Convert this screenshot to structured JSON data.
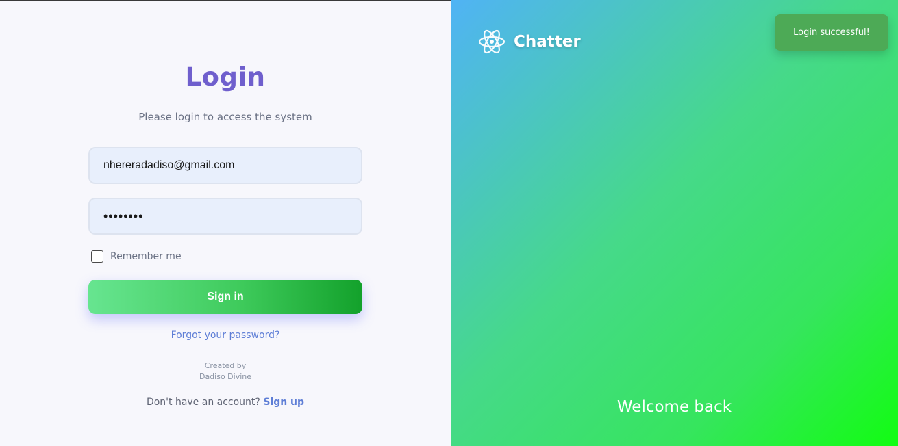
{
  "login": {
    "title": "Login",
    "subtitle": "Please login to access the system",
    "email_value": "nhereradadiso@gmail.com",
    "password_value": "••••••••",
    "remember_label": "Remember me",
    "signin_label": "Sign in",
    "forgot_label": "Forgot your password?",
    "credit_line1": "Created by",
    "credit_line2": "Dadiso Divine",
    "signup_prompt": "Don't have an account?",
    "signup_label": "Sign up"
  },
  "brand": {
    "name": "Chatter",
    "icon": "atom-icon"
  },
  "toast": {
    "message": "Login successful!"
  },
  "hero": {
    "welcome": "Welcome back"
  },
  "colors": {
    "accent_title": "#6f5fcd",
    "link": "#5e7ed6",
    "button_start": "#67e590",
    "button_end": "#13a12b",
    "toast": "#4daa56"
  }
}
